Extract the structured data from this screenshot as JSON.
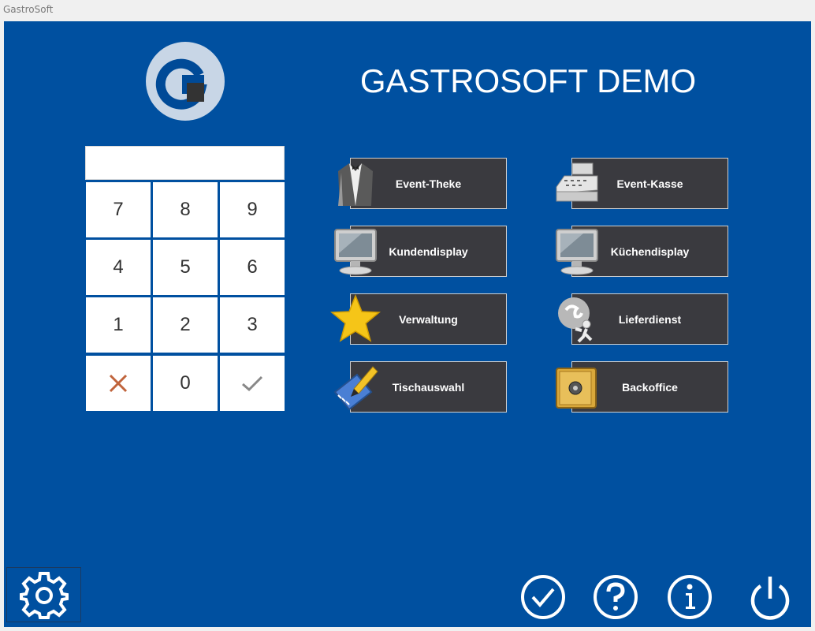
{
  "window": {
    "title": "GastroSoft"
  },
  "header": {
    "title": "GASTROSOFT DEMO"
  },
  "pin": {
    "value": ""
  },
  "keypad": {
    "keys": [
      "7",
      "8",
      "9",
      "4",
      "5",
      "6",
      "1",
      "2",
      "3",
      "0"
    ],
    "clear_icon": "x-icon",
    "confirm_icon": "checkmark-icon"
  },
  "tiles": [
    {
      "label": "Event-Theke",
      "icon": "waiter-icon"
    },
    {
      "label": "Event-Kasse",
      "icon": "cash-register-icon"
    },
    {
      "label": "Kundendisplay",
      "icon": "monitor-icon"
    },
    {
      "label": "Küchendisplay",
      "icon": "monitor-icon"
    },
    {
      "label": "Verwaltung",
      "icon": "star-icon"
    },
    {
      "label": "Lieferdienst",
      "icon": "delivery-icon"
    },
    {
      "label": "Tischauswahl",
      "icon": "notebook-pen-icon"
    },
    {
      "label": "Backoffice",
      "icon": "safe-icon"
    }
  ],
  "footer": {
    "icons": [
      "settings-icon",
      "check-circle-icon",
      "help-icon",
      "info-icon",
      "power-icon"
    ]
  },
  "colors": {
    "background": "#0050a0",
    "tile": "#3a3a3f",
    "clear": "#c0643c",
    "confirm": "#888888"
  }
}
